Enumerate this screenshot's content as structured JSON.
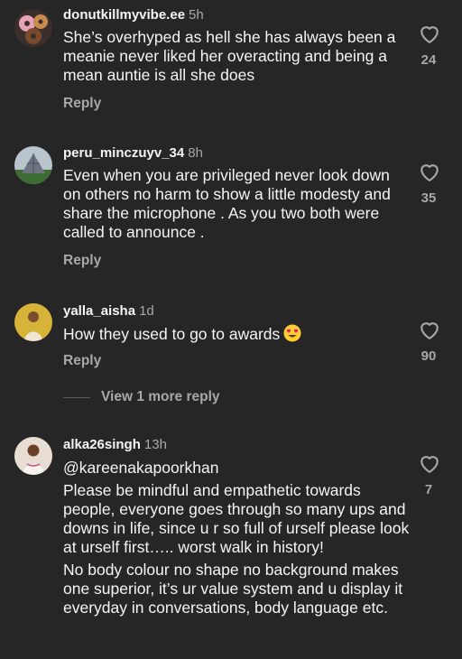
{
  "comments": [
    {
      "username": "donutkillmyvibe.ee",
      "time": "5h",
      "text": "She’s overhyped as hell she has always been a meanie never liked her overacting and being a mean auntie is all she does",
      "reply": "Reply",
      "likes": "24",
      "avatar_icon": "donut-avatar-icon"
    },
    {
      "username": "peru_minczuyv_34",
      "time": "8h",
      "text": "Even  when you are privileged never look down on others  no harm to show a little modesty and share the microphone . As you two both were called to announce .",
      "reply": "Reply",
      "likes": "35",
      "avatar_icon": "pyramid-avatar-icon"
    },
    {
      "username": "yalla_aisha",
      "time": "1d",
      "text": "How they used to go to awards",
      "emoji": "heart-eyes-emoji-icon",
      "reply": "Reply",
      "likes": "90",
      "view_more": "View 1 more reply",
      "avatar_icon": "person-avatar-icon"
    },
    {
      "username": "alka26singh",
      "time": "13h",
      "mention": "@kareenakapoorkhan",
      "text": "Please be mindful and empathetic towards people, everyone goes through so many ups and downs in life, since u r so full of urself please look at urself first….. worst walk in history!",
      "text2": "No body colour no shape no background makes  one superior, it’s ur value system and u display it everyday in conversations, body language etc.",
      "likes": "7",
      "avatar_icon": "person-avatar-icon"
    }
  ],
  "colors": {
    "background": "#262626",
    "primary_text": "#f5f5f5",
    "secondary_text": "#a8a8a8"
  }
}
